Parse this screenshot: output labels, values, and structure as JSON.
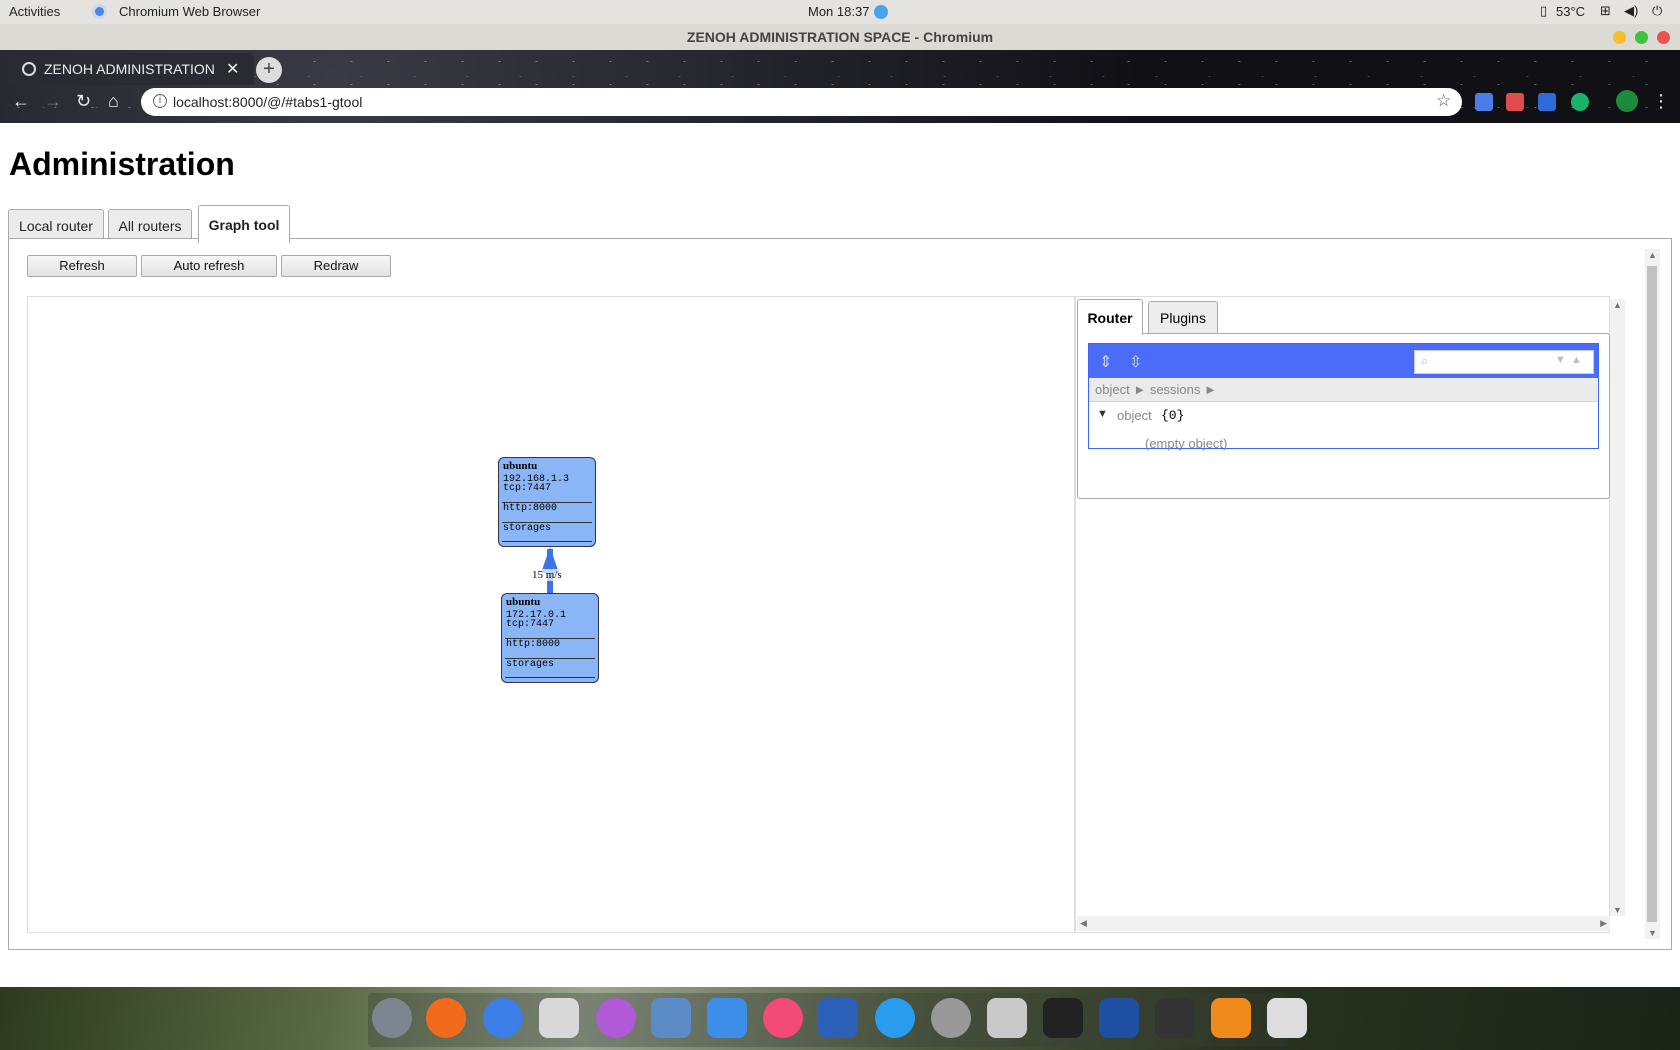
{
  "topbar": {
    "activities": "Activities",
    "app_name": "Chromium Web Browser",
    "clock": "Mon 18:37",
    "temperature": "53°C"
  },
  "window": {
    "title": "ZENOH ADMINISTRATION SPACE - Chromium"
  },
  "browser": {
    "tab_title": "ZENOH ADMINISTRATION",
    "url": "localhost:8000/@/#tabs1-gtool"
  },
  "page": {
    "heading": "Administration",
    "tabs": [
      {
        "label": "Local router"
      },
      {
        "label": "All routers"
      },
      {
        "label": "Graph tool"
      }
    ],
    "buttons": {
      "refresh": "Refresh",
      "auto_refresh": "Auto refresh",
      "redraw": "Redraw"
    },
    "graph": {
      "nodes": [
        {
          "name": "ubuntu",
          "ip": "192.168.1.3",
          "locator": "tcp:7447",
          "http": "http:8000",
          "storages": "storages"
        },
        {
          "name": "ubuntu",
          "ip": "172.17.0.1",
          "locator": "tcp:7447",
          "http": "http:8000",
          "storages": "storages"
        }
      ],
      "edge_label": "15 m/s"
    },
    "detail": {
      "tabs": [
        {
          "label": "Router"
        },
        {
          "label": "Plugins"
        }
      ],
      "breadcrumb": [
        "object",
        "sessions"
      ],
      "tree_root_label": "object",
      "tree_root_count": "{0}",
      "empty_text": "(empty object)"
    }
  },
  "colors": {
    "node_fill": "#8ab6f7",
    "edge": "#3d72e8",
    "json_menu": "#4a6cf6"
  }
}
